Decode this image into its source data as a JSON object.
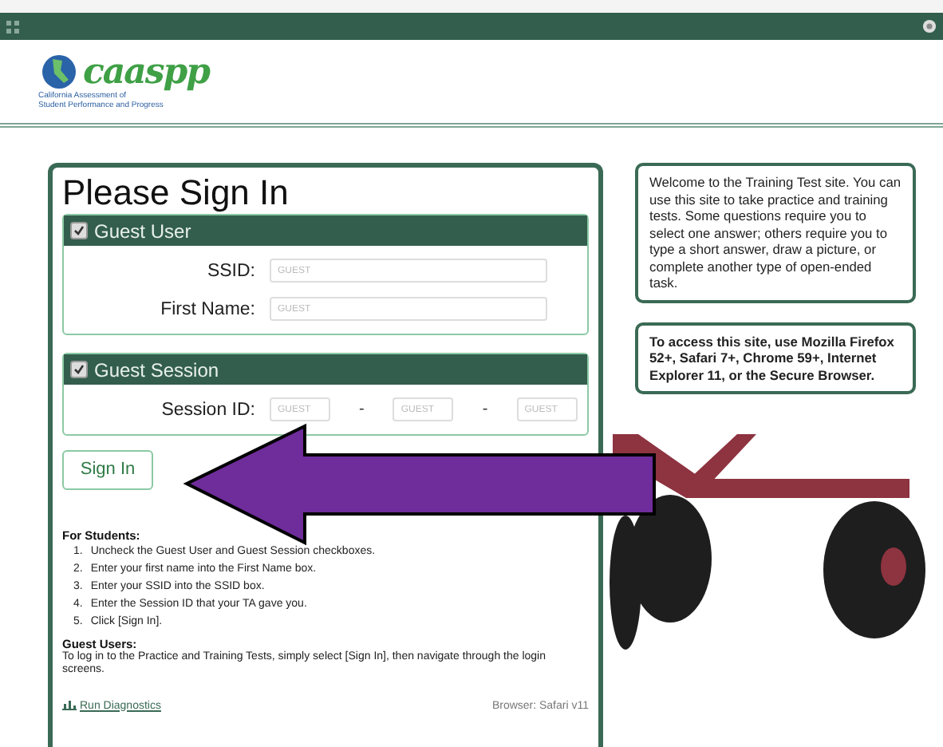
{
  "header": {
    "logo_text": "caaspp",
    "logo_caption": [
      "California Assessment of",
      "Student Performance and Progress"
    ]
  },
  "sign_in": {
    "title": "Please Sign In",
    "sections": [
      {
        "title": "Guest User",
        "checked": true,
        "fields": [
          {
            "kind": "single",
            "label": "SSID:",
            "placeholder": "GUEST"
          },
          {
            "kind": "single",
            "label": "First Name:",
            "placeholder": "GUEST"
          }
        ]
      },
      {
        "title": "Guest Session",
        "checked": true,
        "fields": [
          {
            "kind": "split",
            "label": "Session ID:",
            "parts": [
              {
                "placeholder": "GUEST"
              },
              {
                "placeholder": "GUEST"
              },
              {
                "placeholder": "GUEST"
              }
            ],
            "separators": [
              "-",
              "-"
            ]
          }
        ]
      }
    ],
    "button": "Sign In",
    "students": {
      "heading": "For Students:",
      "steps": [
        {
          "number": "1.",
          "text": "Uncheck the Guest User and Guest Session checkboxes."
        },
        {
          "number": "2.",
          "text": "Enter your first name into the First Name box."
        },
        {
          "number": "3.",
          "text": "Enter your SSID into the SSID box."
        },
        {
          "number": "4.",
          "text": "Enter the Session ID that your TA gave you."
        },
        {
          "number": "5.",
          "text": "Click [Sign In]."
        }
      ]
    },
    "guest_users": {
      "heading": "Guest Users:",
      "text": "To log in to the Practice and Training Tests, simply select [Sign In], then navigate through the login screens."
    },
    "footer": {
      "link": "Run Diagnostics",
      "browser": "Browser: Safari v11"
    }
  },
  "info": [
    {
      "kind": "plain",
      "text": "Welcome to the Training Test site. You can use this site to take practice and training tests. Some questions require you to select one answer; others require you to type a short answer, draw a picture, or complete another type of open-ended task."
    },
    {
      "kind": "bold",
      "text": "To access this site, use Mozilla Firefox 52+, Safari 7+, Chrome 59+, Internet Explorer 11, or the Secure Browser."
    }
  ]
}
